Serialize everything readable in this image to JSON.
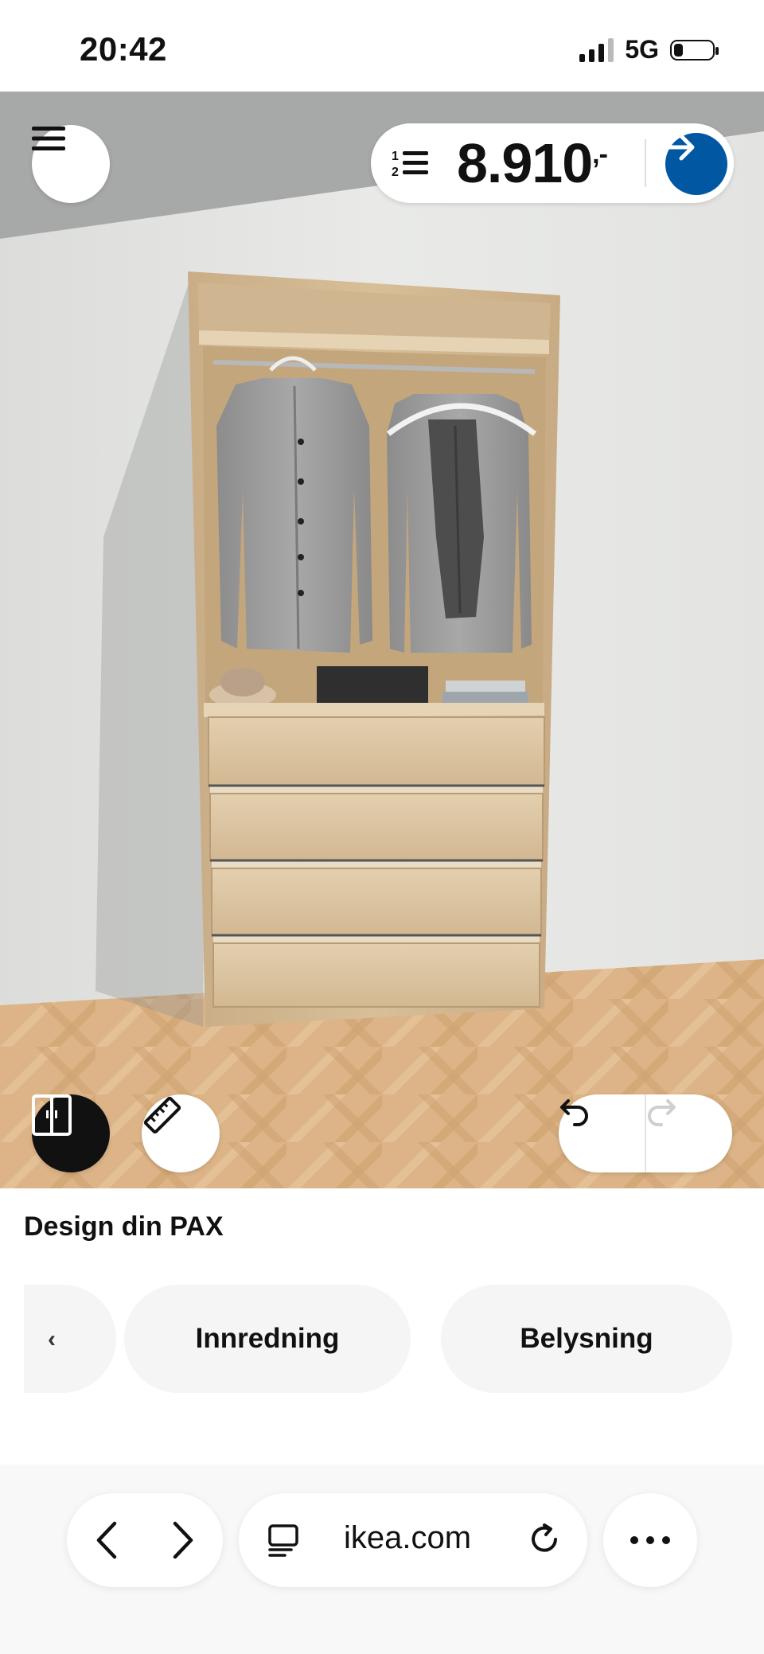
{
  "status_bar": {
    "time": "20:42",
    "network": "5G",
    "battery_level": 0.25,
    "signal_bars_active": 3
  },
  "viewer": {
    "price": "8.910",
    "price_suffix": ",-",
    "icons": {
      "menu": "menu-icon",
      "list": "numbered-list-icon",
      "proceed": "arrow-right-icon",
      "doors": "wardrobe-doors-icon",
      "measure": "ruler-icon",
      "undo": "undo-icon",
      "redo": "redo-icon"
    },
    "colors": {
      "accent": "#0058a3",
      "wall": "#e7e8e6",
      "floor": "#d9b184",
      "wood": "#d4bb94"
    }
  },
  "panel": {
    "title": "Design din PAX",
    "chips": [
      "Innredning",
      "Belysning"
    ]
  },
  "browser": {
    "url": "ikea.com",
    "icons": {
      "back": "chevron-left-icon",
      "forward": "chevron-right-icon",
      "reader": "reader-mode-icon",
      "reload": "reload-icon",
      "more": "more-icon"
    }
  }
}
